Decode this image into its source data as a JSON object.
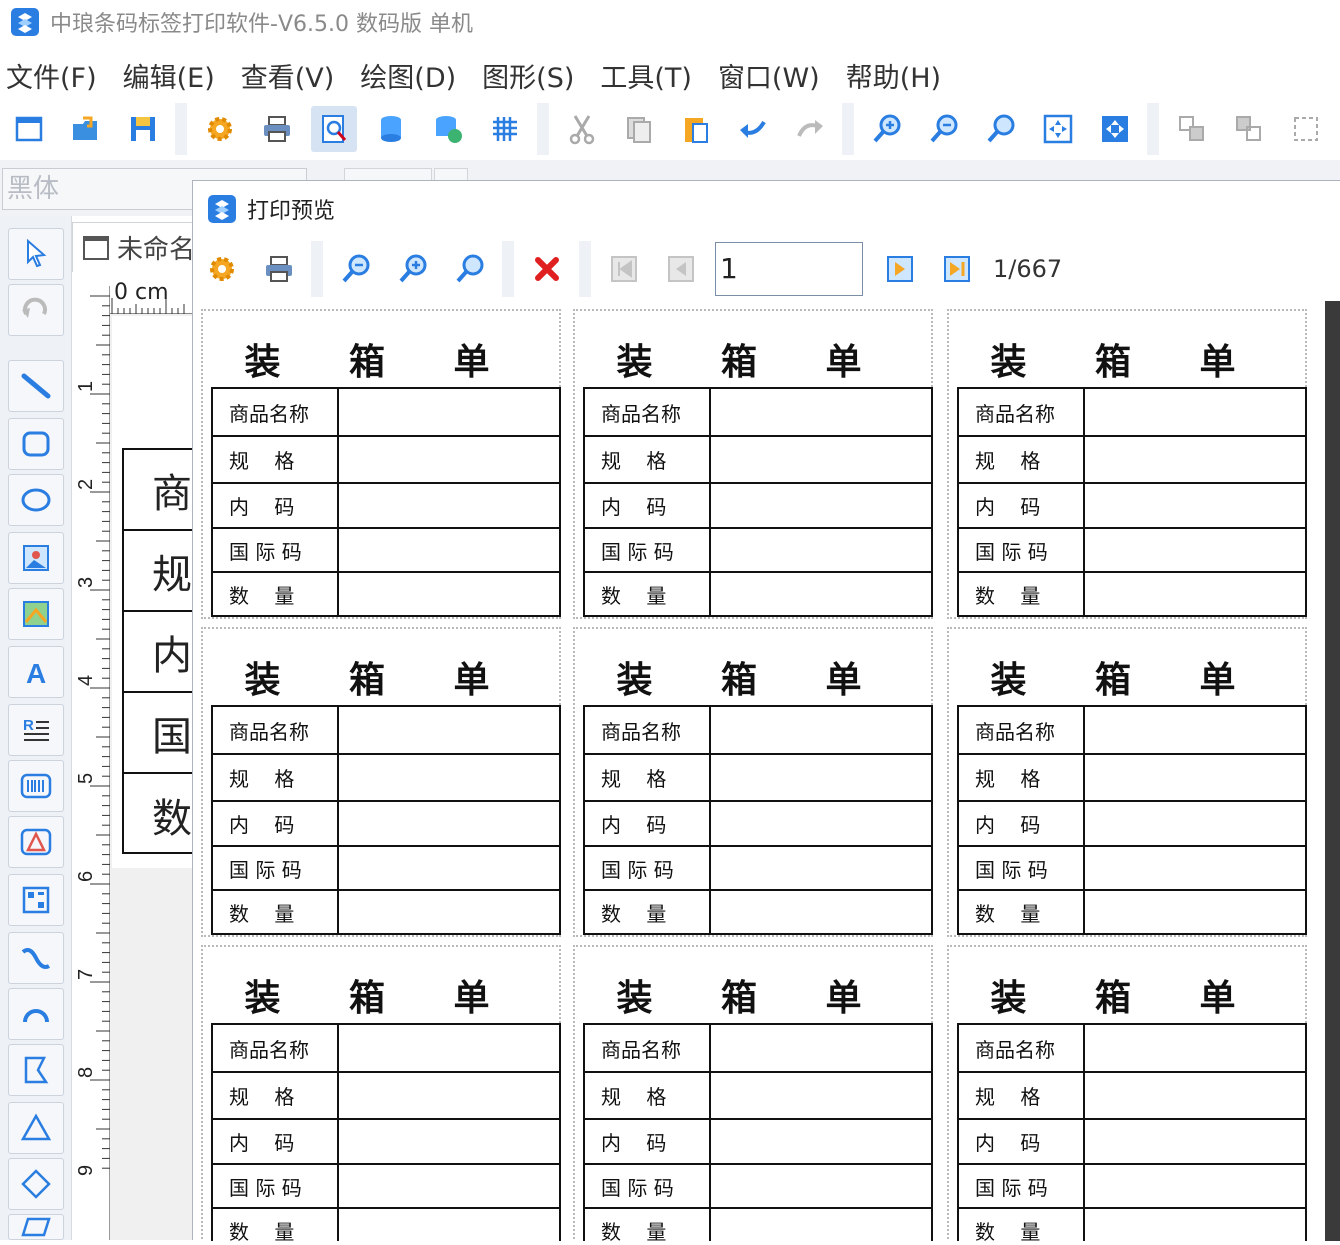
{
  "window": {
    "title": "中琅条码标签打印软件-V6.5.0 数码版 单机"
  },
  "menu": [
    "文件(F)",
    "编辑(E)",
    "查看(V)",
    "绘图(D)",
    "图形(S)",
    "工具(T)",
    "窗口(W)",
    "帮助(H)"
  ],
  "toolbar": {
    "icons": [
      "new-file-icon",
      "open-folder-icon",
      "save-icon",
      "settings-gear-icon",
      "print-icon",
      "print-preview-icon",
      "database-icon",
      "database-link-icon",
      "grid-icon",
      "cut-icon",
      "copy-icon",
      "paste-icon",
      "undo-icon",
      "redo-icon",
      "zoom-in-icon",
      "zoom-out-icon",
      "zoom-fit-icon",
      "fit-page-icon",
      "fit-width-icon",
      "group-icon",
      "ungroup-icon",
      "select-frame-icon"
    ]
  },
  "font": {
    "value": "黑体"
  },
  "document_tab": {
    "label": "未命名"
  },
  "ruler": {
    "top_label": "0 cm",
    "marks": [
      "1",
      "2",
      "3",
      "4",
      "5",
      "6",
      "7",
      "8",
      "9"
    ]
  },
  "design_rows": [
    "商",
    "规",
    "内",
    "国",
    "数"
  ],
  "preview": {
    "title": "打印预览",
    "page_input": "1",
    "page_count": "1/667",
    "label_title": "装 箱 单",
    "fields": [
      "商品名称",
      "规    格",
      "内    码",
      "国 际 码",
      "数    量"
    ]
  },
  "colors": {
    "accent": "#2a7de1",
    "active": "#d6e3f3"
  }
}
